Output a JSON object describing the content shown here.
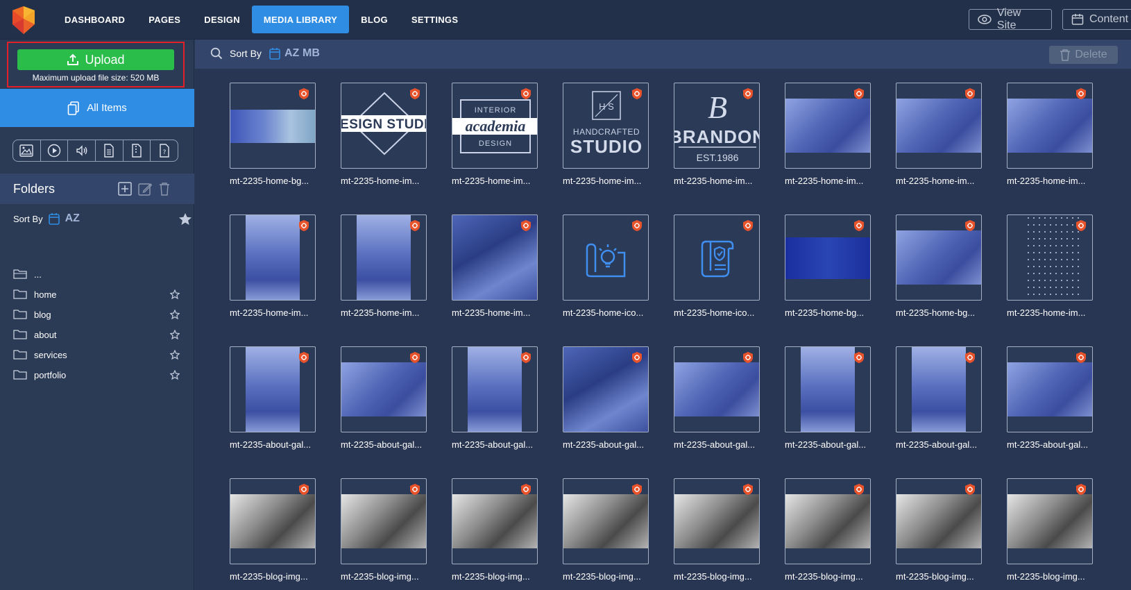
{
  "nav": {
    "items": [
      {
        "label": "DASHBOARD",
        "active": false
      },
      {
        "label": "PAGES",
        "active": false
      },
      {
        "label": "DESIGN",
        "active": false
      },
      {
        "label": "MEDIA LIBRARY",
        "active": true
      },
      {
        "label": "BLOG",
        "active": false
      },
      {
        "label": "SETTINGS",
        "active": false
      }
    ],
    "view_site_label": "View Site",
    "content_label": "Content"
  },
  "sidebar": {
    "upload_label": "Upload",
    "upload_note": "Maximum upload file size: 520 MB",
    "all_items_label": "All Items",
    "filters": [
      "image-filter-icon",
      "video-filter-icon",
      "audio-filter-icon",
      "document-filter-icon",
      "archive-filter-icon",
      "other-filter-icon"
    ],
    "folders_title": "Folders",
    "sort_by_label": "Sort By",
    "sort_az_label": "AZ",
    "folders": [
      {
        "label": "..."
      },
      {
        "label": "home"
      },
      {
        "label": "blog"
      },
      {
        "label": "about"
      },
      {
        "label": "services"
      },
      {
        "label": "portfolio"
      }
    ]
  },
  "toolbar": {
    "sort_by_label": "Sort By",
    "az_label": "AZ",
    "mb_label": "MB",
    "delete_label": "Delete"
  },
  "media": [
    {
      "name": "mt-2235-home-bg...",
      "kind": "wide-photo"
    },
    {
      "name": "mt-2235-home-im...",
      "kind": "logo-design-studio"
    },
    {
      "name": "mt-2235-home-im...",
      "kind": "logo-academia"
    },
    {
      "name": "mt-2235-home-im...",
      "kind": "logo-handcrafted"
    },
    {
      "name": "mt-2235-home-im...",
      "kind": "logo-brandon"
    },
    {
      "name": "mt-2235-home-im...",
      "kind": "team-photo"
    },
    {
      "name": "mt-2235-home-im...",
      "kind": "team-photo"
    },
    {
      "name": "mt-2235-home-im...",
      "kind": "team-photo"
    },
    {
      "name": "mt-2235-home-im...",
      "kind": "tall-photo"
    },
    {
      "name": "mt-2235-home-im...",
      "kind": "tall-photo"
    },
    {
      "name": "mt-2235-home-im...",
      "kind": "full-photo"
    },
    {
      "name": "mt-2235-home-ico...",
      "kind": "icon-idea"
    },
    {
      "name": "mt-2235-home-ico...",
      "kind": "icon-scroll"
    },
    {
      "name": "mt-2235-home-bg...",
      "kind": "gradient-bg"
    },
    {
      "name": "mt-2235-home-bg...",
      "kind": "team-photo"
    },
    {
      "name": "mt-2235-home-im...",
      "kind": "dots"
    },
    {
      "name": "mt-2235-about-gal...",
      "kind": "tall-photo"
    },
    {
      "name": "mt-2235-about-gal...",
      "kind": "team-photo"
    },
    {
      "name": "mt-2235-about-gal...",
      "kind": "tall-photo"
    },
    {
      "name": "mt-2235-about-gal...",
      "kind": "full-photo"
    },
    {
      "name": "mt-2235-about-gal...",
      "kind": "team-photo"
    },
    {
      "name": "mt-2235-about-gal...",
      "kind": "tall-photo"
    },
    {
      "name": "mt-2235-about-gal...",
      "kind": "tall-photo"
    },
    {
      "name": "mt-2235-about-gal...",
      "kind": "team-photo"
    },
    {
      "name": "mt-2235-blog-img...",
      "kind": "gray-photo"
    },
    {
      "name": "mt-2235-blog-img...",
      "kind": "gray-photo"
    },
    {
      "name": "mt-2235-blog-img...",
      "kind": "gray-photo"
    },
    {
      "name": "mt-2235-blog-img...",
      "kind": "gray-photo"
    },
    {
      "name": "mt-2235-blog-img...",
      "kind": "gray-photo"
    },
    {
      "name": "mt-2235-blog-img...",
      "kind": "gray-photo"
    },
    {
      "name": "mt-2235-blog-img...",
      "kind": "gray-photo"
    },
    {
      "name": "mt-2235-blog-img...",
      "kind": "gray-photo"
    }
  ],
  "logo_text": {
    "design_studio": "DESIGN STUDIO",
    "interior": "INTERIOR",
    "academia": "academia",
    "design": "DESIGN",
    "hs": "H  S",
    "handcrafted": "HANDCRAFTED",
    "studio": "STUDIO",
    "brandon": "BRANDON",
    "est": "EST.1986"
  },
  "colors": {
    "accent": "#2f8de4",
    "upload": "#2bbd4a",
    "highlight_border": "#e2202a",
    "badge": "#e8532c"
  }
}
